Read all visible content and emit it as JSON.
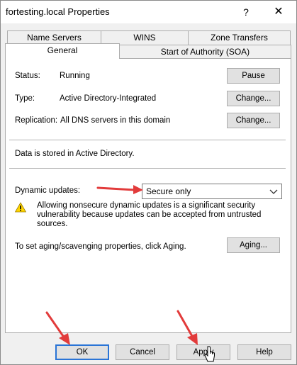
{
  "window": {
    "title": "fortesting.local Properties",
    "help_glyph": "?",
    "close_glyph": "✕"
  },
  "tabs": {
    "row_back": [
      "Name Servers",
      "WINS",
      "Zone Transfers"
    ],
    "row_front": [
      "General",
      "Start of Authority (SOA)"
    ],
    "active": "General"
  },
  "general": {
    "status_label": "Status:",
    "status_value": "Running",
    "pause_button": "Pause",
    "type_label": "Type:",
    "type_value": "Active Directory-Integrated",
    "type_change_button": "Change...",
    "replication_label": "Replication:",
    "replication_value": "All DNS servers in this domain",
    "replication_change_button": "Change...",
    "storage_note": "Data is stored in Active Directory.",
    "dynamic_updates_label": "Dynamic updates:",
    "dynamic_updates_value": "Secure only",
    "warning_text": "Allowing nonsecure dynamic updates is a significant security vulnerability because updates can be accepted from untrusted sources.",
    "aging_text": "To set aging/scavenging properties, click Aging.",
    "aging_button": "Aging..."
  },
  "footer": {
    "ok": "OK",
    "cancel": "Cancel",
    "apply": "Apply",
    "help": "Help"
  },
  "annotation_arrow_color": "#e23b3b",
  "icons": {
    "warning": "warning-icon",
    "dropdown": "chevron-down-icon",
    "cursor": "pointer-cursor-icon"
  }
}
